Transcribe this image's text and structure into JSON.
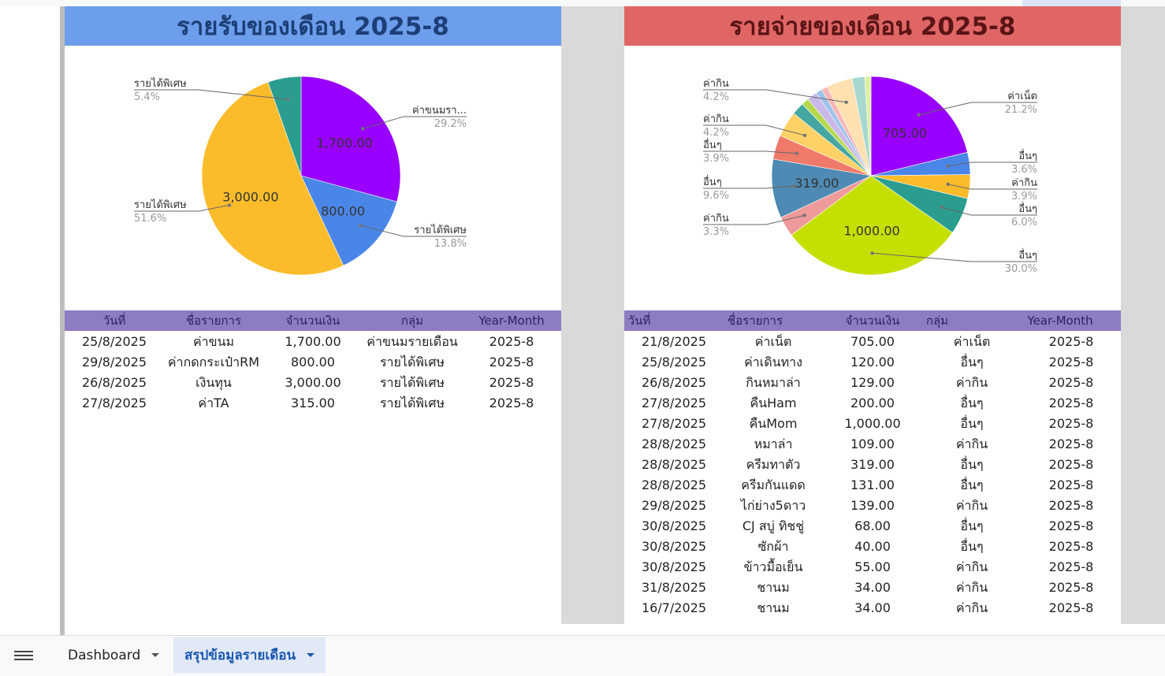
{
  "income": {
    "title": "รายรับของเดือน 2025-8",
    "columns": [
      "วันที่",
      "ชื่อรายการ",
      "จำนวนเงิน",
      "กลุ่ม",
      "Year-Month"
    ],
    "rows": [
      [
        "25/8/2025",
        "ค่าขนม",
        "1,700.00",
        "ค่าขนมรายเดือน",
        "2025-8"
      ],
      [
        "29/8/2025",
        "ค่ากดกระเป๋าRM",
        "800.00",
        "รายได้พิเศษ",
        "2025-8"
      ],
      [
        "26/8/2025",
        "เงินทุน",
        "3,000.00",
        "รายได้พิเศษ",
        "2025-8"
      ],
      [
        "27/8/2025",
        "ค่าTA",
        "315.00",
        "รายได้พิเศษ",
        "2025-8"
      ]
    ]
  },
  "expense": {
    "title": "รายจ่ายของเดือน 2025-8",
    "columns": [
      "วันที่",
      "ชื่อรายการ",
      "จำนวนเงิน",
      "กลุ่ม",
      "Year-Month"
    ],
    "rows": [
      [
        "21/8/2025",
        "ค่าเน็ต",
        "705.00",
        "ค่าเน็ต",
        "2025-8"
      ],
      [
        "25/8/2025",
        "ค่าเดินทาง",
        "120.00",
        "อื่นๆ",
        "2025-8"
      ],
      [
        "26/8/2025",
        "กินหมาล่า",
        "129.00",
        "ค่ากิน",
        "2025-8"
      ],
      [
        "27/8/2025",
        "คืนHam",
        "200.00",
        "อื่นๆ",
        "2025-8"
      ],
      [
        "27/8/2025",
        "คืนMom",
        "1,000.00",
        "อื่นๆ",
        "2025-8"
      ],
      [
        "28/8/2025",
        "หมาล่า",
        "109.00",
        "ค่ากิน",
        "2025-8"
      ],
      [
        "28/8/2025",
        "ครีมทาตัว",
        "319.00",
        "อื่นๆ",
        "2025-8"
      ],
      [
        "28/8/2025",
        "ครีมกันแดด",
        "131.00",
        "อื่นๆ",
        "2025-8"
      ],
      [
        "29/8/2025",
        "ไก่ย่าง5ดาว",
        "139.00",
        "ค่ากิน",
        "2025-8"
      ],
      [
        "30/8/2025",
        "CJ สบู่ ทิชชู่",
        "68.00",
        "อื่นๆ",
        "2025-8"
      ],
      [
        "30/8/2025",
        "ซักผ้า",
        "40.00",
        "อื่นๆ",
        "2025-8"
      ],
      [
        "30/8/2025",
        "ข้าวมื้อเย็น",
        "55.00",
        "ค่ากิน",
        "2025-8"
      ],
      [
        "31/8/2025",
        "ชานม",
        "34.00",
        "ค่ากิน",
        "2025-8"
      ],
      [
        "16/7/2025",
        "ชานม",
        "34.00",
        "ค่ากิน",
        "2025-8"
      ]
    ]
  },
  "tabs": [
    {
      "label": "Dashboard",
      "active": false
    },
    {
      "label": "สรุปข้อมูลรายเดือน",
      "active": true
    }
  ],
  "chart_data": [
    {
      "type": "pie",
      "title": "",
      "slices": [
        {
          "label": "ค่าขนมรา...",
          "value": 1700,
          "percent": "29.2%",
          "color": "#9900ff",
          "data_label": "1,700.00"
        },
        {
          "label": "รายได้พิเศษ",
          "value": 800,
          "percent": "13.8%",
          "color": "#4a86e8",
          "data_label": "800.00"
        },
        {
          "label": "รายได้พิเศษ",
          "value": 3000,
          "percent": "51.6%",
          "color": "#fbbc2b",
          "data_label": "3,000.00"
        },
        {
          "label": "รายได้พิเศษ",
          "value": 315,
          "percent": "5.4%",
          "color": "#2a9d8f",
          "data_label": ""
        }
      ]
    },
    {
      "type": "pie",
      "title": "",
      "slices": [
        {
          "label": "ค่าเน็ต",
          "value": 705,
          "percent": "21.2%",
          "color": "#9900ff",
          "data_label": "705.00"
        },
        {
          "label": "อื่นๆ",
          "value": 120,
          "percent": "3.6%",
          "color": "#4a86e8",
          "data_label": ""
        },
        {
          "label": "ค่ากิน",
          "value": 129,
          "percent": "3.9%",
          "color": "#fbbc2b",
          "data_label": ""
        },
        {
          "label": "อื่นๆ",
          "value": 200,
          "percent": "6.0%",
          "color": "#2a9d8f",
          "data_label": ""
        },
        {
          "label": "อื่นๆ",
          "value": 1000,
          "percent": "30.0%",
          "color": "#c5e000",
          "data_label": "1,000.00"
        },
        {
          "label": "ค่ากิน",
          "value": 109,
          "percent": "3.3%",
          "color": "#ee9a9a",
          "data_label": ""
        },
        {
          "label": "อื่นๆ",
          "value": 319,
          "percent": "9.6%",
          "color": "#4e8ab3",
          "data_label": "319.00"
        },
        {
          "label": "อื่นๆ",
          "value": 131,
          "percent": "3.9%",
          "color": "#f07a6a",
          "data_label": ""
        },
        {
          "label": "ค่ากิน",
          "value": 139,
          "percent": "4.2%",
          "color": "#ffd166",
          "data_label": ""
        },
        {
          "label": "อื่นๆ",
          "value": 68,
          "percent": "",
          "color": "#45a8a0",
          "data_label": ""
        },
        {
          "label": "อื่นๆ",
          "value": 40,
          "percent": "",
          "color": "#b5d94c",
          "data_label": ""
        },
        {
          "label": "ค่ากิน",
          "value": 55,
          "percent": "",
          "color": "#c9b8e8",
          "data_label": ""
        },
        {
          "label": "ค่ากิน",
          "value": 34,
          "percent": "",
          "color": "#9fc3ea",
          "data_label": ""
        },
        {
          "label": "ค่ากิน",
          "value": 34,
          "percent": "",
          "color": "#f7b6b6",
          "data_label": ""
        },
        {
          "label": "ค่ากิน",
          "value": 139,
          "percent": "4.2%",
          "color": "#ffe0b0",
          "data_label": ""
        },
        {
          "label": "",
          "value": 68,
          "percent": "",
          "color": "#a8d8d0",
          "data_label": ""
        },
        {
          "label": "",
          "value": 34,
          "percent": "",
          "color": "#dff0a0",
          "data_label": ""
        }
      ]
    }
  ]
}
